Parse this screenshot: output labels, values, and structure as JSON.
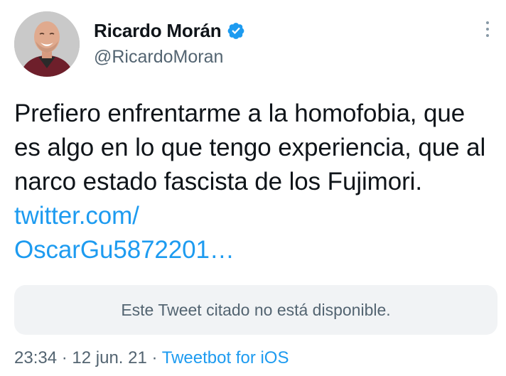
{
  "author": {
    "display_name": "Ricardo Morán",
    "handle": "@RicardoMoran",
    "verified": true
  },
  "tweet": {
    "text": "Prefiero enfrentarme a la homofobia, que es algo en lo que tengo experiencia, que al narco estado fascista de los Fujimori.",
    "link_line1": "twitter.com/",
    "link_line2": "OscarGu5872201…"
  },
  "quote": {
    "unavailable_text": "Este Tweet citado no está disponible."
  },
  "meta": {
    "time": "23:34",
    "separator": "·",
    "date": "12 jun. 21",
    "source": "Tweetbot for iOS"
  },
  "colors": {
    "link": "#1d9bf0",
    "secondary_text": "#536471",
    "verified_badge": "#1d9bf0",
    "quote_background": "#f1f3f5"
  },
  "icons": {
    "verified": "verified-badge-icon",
    "more": "more-options-icon"
  }
}
